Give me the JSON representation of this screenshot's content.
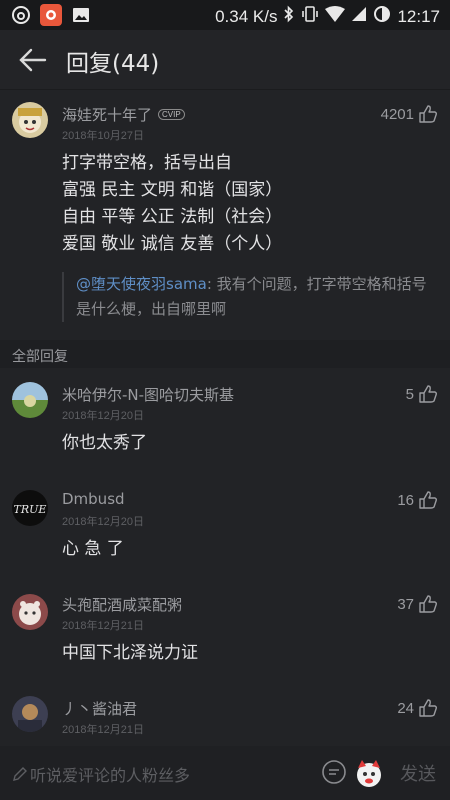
{
  "status_bar": {
    "speed": "0.34 K/s",
    "time": "12:17",
    "icons": [
      "netease-music-icon",
      "app-icon",
      "image-icon",
      "bluetooth-icon",
      "vibrate-icon",
      "wifi-icon",
      "signal-icon",
      "battery-icon"
    ]
  },
  "header": {
    "title": "回复(44)"
  },
  "main_comment": {
    "username": "海娃死十年了",
    "badge": "CVIP",
    "date": "2018年10月27日",
    "likes": "4201",
    "lines": [
      "打字带空格，括号出自",
      "富强 民主 文明 和谐（国家）",
      "自由 平等 公正 法制（社会）",
      "爱国 敬业 诚信 友善（个人）"
    ],
    "quote_mention": "@堕天使夜羽sama",
    "quote_text": ": 我有个问题，打字带空格和括号是什么梗，出自哪里啊"
  },
  "section_label": "全部回复",
  "replies": [
    {
      "username": "米哈伊尔-N-图哈切夫斯基",
      "date": "2018年12月20日",
      "likes": "5",
      "text": "你也太秀了"
    },
    {
      "username": "Dmbusd",
      "date": "2018年12月20日",
      "likes": "16",
      "text": "心 急 了"
    },
    {
      "username": "头孢配酒咸菜配粥",
      "date": "2018年12月21日",
      "likes": "37",
      "text": "中国下北泽说力证"
    },
    {
      "username": "丿丶酱油君",
      "date": "2018年12月21日",
      "likes": "24",
      "text": ""
    }
  ],
  "bottom_bar": {
    "placeholder": "听说爱评论的人粉丝多",
    "send_label": "发送"
  },
  "colors": {
    "background": "#222326",
    "mention": "#5f8fc7",
    "app_icon": "#e8573b"
  }
}
